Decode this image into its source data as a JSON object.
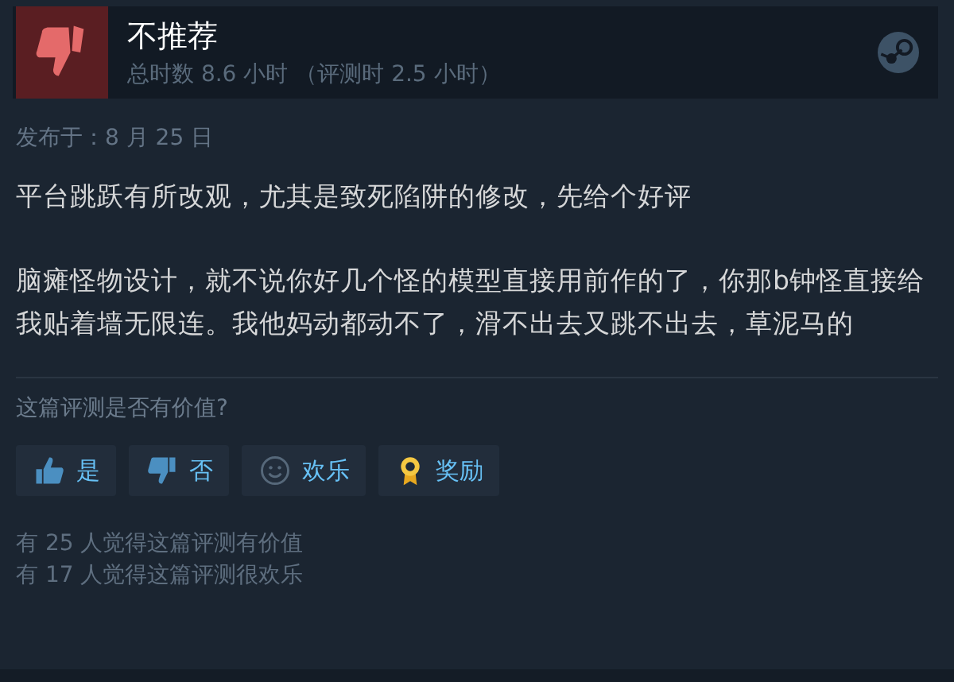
{
  "review": {
    "kind": "not_recommended",
    "title": "不推荐",
    "hours": "总时数 8.6 小时 （评测时 2.5 小时）",
    "posted": "发布于：8 月 25 日",
    "paragraphs": [
      "平台跳跃有所改观，尤其是致死陷阱的修改，先给个好评",
      "脑瘫怪物设计，就不说你好几个怪的模型直接用前作的了，你那b钟怪直接给我贴着墙无限连。我他妈动都动不了，滑不出去又跳不出去，草泥马的"
    ]
  },
  "feedback": {
    "question": "这篇评测是否有价值?",
    "buttons": [
      {
        "kind": "thumb_up",
        "label": "是"
      },
      {
        "kind": "thumb_down",
        "label": "否"
      },
      {
        "kind": "smile",
        "label": "欢乐"
      },
      {
        "kind": "award",
        "label": "奖励"
      }
    ],
    "counts": [
      "有 25 人觉得这篇评测有价值",
      "有 17 人觉得这篇评测很欢乐"
    ]
  }
}
